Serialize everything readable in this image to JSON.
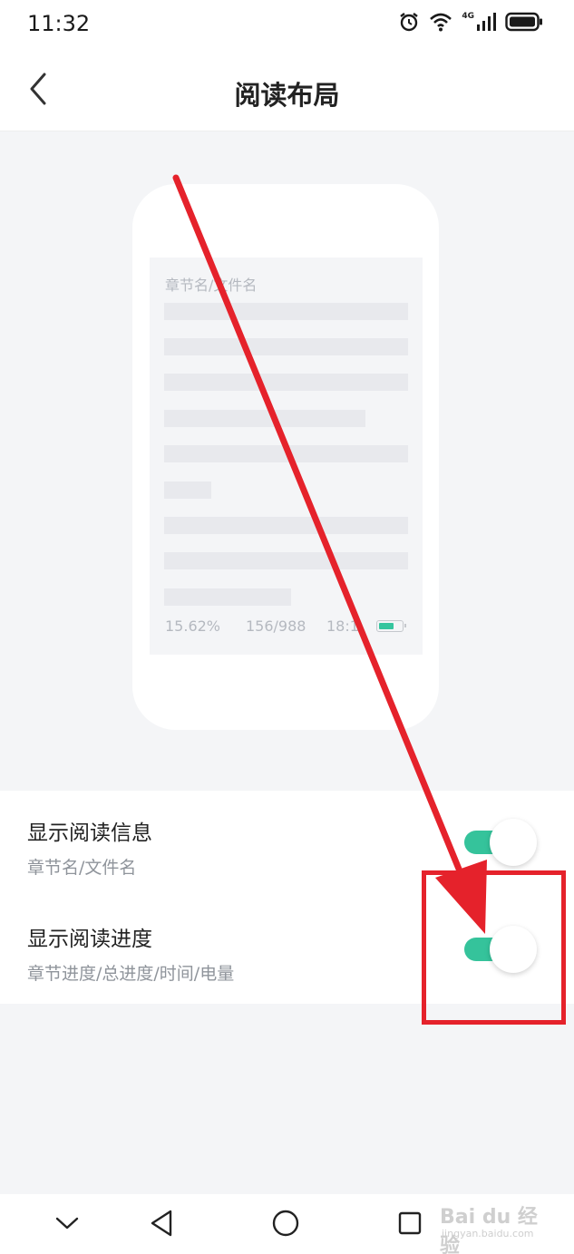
{
  "status_bar": {
    "time": "11:32",
    "network_label": "4G",
    "icons": [
      "alarm-icon",
      "wifi-icon",
      "signal-icon",
      "battery-icon"
    ]
  },
  "header": {
    "title": "阅读布局",
    "back_icon": "chevron-left-icon"
  },
  "preview": {
    "heading": "章节名/文件名",
    "footer": {
      "percent": "15.62%",
      "pages": "156/988",
      "time": "18:1"
    },
    "battery_level": 0.7
  },
  "settings": [
    {
      "title": "显示阅读信息",
      "subtitle": "章节名/文件名",
      "enabled": true
    },
    {
      "title": "显示阅读进度",
      "subtitle": "章节进度/总进度/时间/电量",
      "enabled": true
    }
  ],
  "nav_bar": {
    "icons": [
      "chevron-down-icon",
      "back-triangle-icon",
      "home-circle-icon",
      "recents-square-icon"
    ]
  },
  "watermark": {
    "main": "Bai du 经验",
    "sub": "jingyan.baidu.com"
  },
  "colors": {
    "accent": "#35c39b",
    "annotation": "#e5222b",
    "background": "#f4f5f7"
  }
}
